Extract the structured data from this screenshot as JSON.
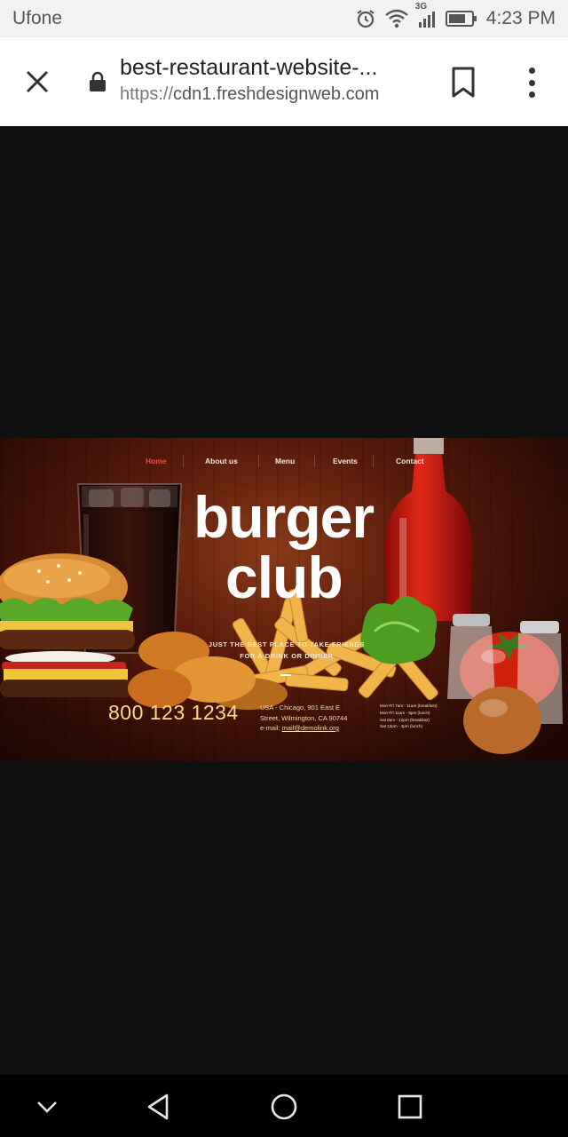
{
  "status_bar": {
    "carrier": "Ufone",
    "network": "3G",
    "time": "4:23 PM",
    "icons": [
      "alarm-icon",
      "wifi-icon",
      "signal-icon",
      "battery-icon"
    ]
  },
  "browser": {
    "page_title": "best-restaurant-website-...",
    "url_protocol": "https://",
    "url_host": "cdn1.freshdesignweb.com",
    "icons": [
      "close-icon",
      "lock-icon",
      "bookmark-icon",
      "more-vert-icon"
    ]
  },
  "hero": {
    "nav": [
      "Home",
      "About us",
      "Menu",
      "Events",
      "Contact"
    ],
    "active_nav": "Home",
    "brand_line1": "burger",
    "brand_line2": "club",
    "tagline_line1": "JUST THE BEST PLACE TO TAKE FRIENDS",
    "tagline_line2": "FOR A DRINK OR DINNER",
    "phone": "800 123 1234",
    "address_line1": "USA - Chicago, 901 East E",
    "address_line2": "Street, Wilmington, CA 90744",
    "email_label": "e-mail: ",
    "email": "mail@demolink.org",
    "hours": [
      "Mon-Fri 7am - 11am (breakfast)",
      "Mon-Fri 11am - 8pm (lunch)",
      "Sat 8am - 12pm (breakfast)",
      "Sat 12pm - 4pm (lunch)"
    ],
    "colors": {
      "active_nav": "#e8533a",
      "phone": "#ffd98a",
      "background": "#5a1d0b"
    }
  },
  "system_nav": {
    "icons": [
      "chevron-down-icon",
      "back-icon",
      "home-icon",
      "recents-icon"
    ]
  }
}
